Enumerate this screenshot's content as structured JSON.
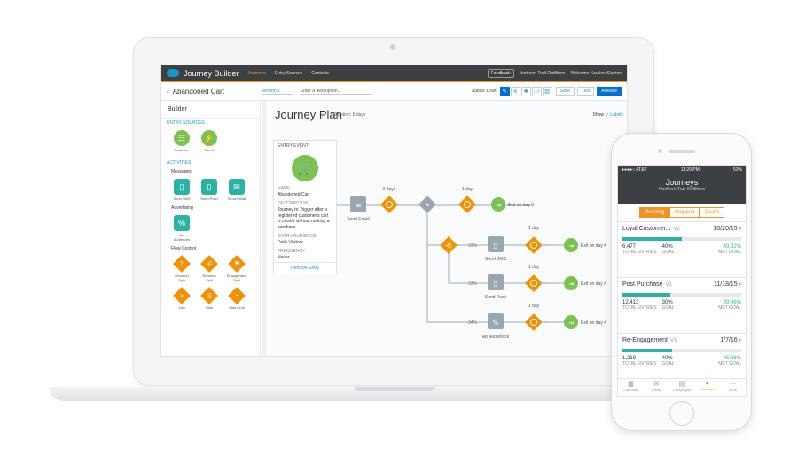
{
  "app": {
    "title": "Journey Builder",
    "nav": [
      "Journeys",
      "Entry Sources",
      "Contacts"
    ],
    "feedback": "Feedback",
    "org": "Northern Trail Outfitters",
    "welcome": "Welcome  Karalee Slayton"
  },
  "subbar": {
    "back": "‹",
    "journey_name": "Abandoned Cart",
    "version": "Version 1",
    "description_placeholder": "Enter a description...",
    "status": "Status: Draft",
    "save": "Save",
    "test": "Test",
    "activate": "Activate"
  },
  "builder": {
    "title": "Builder",
    "entry_sources": "ENTRY SOURCES",
    "entry_tiles": [
      "Audience",
      "Event"
    ],
    "activities": "ACTIVITIES",
    "messages": "Messages",
    "message_tiles": [
      "Send SMS",
      "Send Push",
      "Send Email"
    ],
    "advertising": "Advertising",
    "ad_tiles": [
      "Ad Audiences"
    ],
    "flow_control": "Flow Control",
    "flow_tiles_1": [
      "Decision Split",
      "Random Split",
      "Engagement Split"
    ],
    "flow_tiles_2": [
      "Join",
      "Wait",
      "Wait Limit"
    ]
  },
  "canvas": {
    "title": "Journey Plan",
    "duration": "Duration: 5 days",
    "show": "Show",
    "labels": "✓ Labels",
    "entry": {
      "label": "ENTRY EVENT",
      "name_key": "NAME",
      "name_val": "Abandoned Cart",
      "desc_key": "DESCRIPTION",
      "desc_val": "Journey to Trigger after a registered customer's cart is closed without making a purchase",
      "aud_key": "ENTRY AUDIENCE",
      "aud_val": "Daily Visitors",
      "freq_key": "FREQUENCY",
      "freq_val": "Never",
      "remove": "Remove Entry"
    },
    "nodes": {
      "send_email": "Send Email",
      "d1": "2 days",
      "d2": "1 day",
      "exit1": "Exit on day 3",
      "send_sms": "Send SMS",
      "send_push": "Send Push",
      "ad_aud": "Ad Audiences",
      "d3": "1 day",
      "d4": "1 day",
      "d5": "1 day",
      "exit2": "Exit on day 4",
      "exit3": "Exit on day 4",
      "exit4": "Exit on day 4",
      "p1": "33%",
      "p2": "33%",
      "p3": "34%"
    }
  },
  "phone": {
    "carrier": "●●●●○ AT&T",
    "time": "11:20 PM",
    "battery": "53%",
    "title": "Journeys",
    "subtitle": "Northern Trail Outfitters",
    "tabs": [
      "Running",
      "Stopped",
      "Drafts"
    ],
    "cards": [
      {
        "name": "Loyal Customer...",
        "ver": "V2",
        "date": "10/20/15",
        "fill": 0.5,
        "entries": "6,477",
        "goal": "40%",
        "met": "49.92%",
        "l1": "TOTAL ENTRIES",
        "l2": "GOAL",
        "l3": "MET GOAL"
      },
      {
        "name": "Post Purchase",
        "ver": "V1",
        "date": "11/18/15",
        "fill": 0.4,
        "entries": "12,413",
        "goal": "30%",
        "met": "39.46%",
        "l1": "TOTAL ENTRIES",
        "l2": "GOAL",
        "l3": "MET GOAL"
      },
      {
        "name": "Re-Engagement",
        "ver": "V1",
        "date": "1/7/16",
        "fill": 0.42,
        "entries": "1,219",
        "goal": "40%",
        "met": "45.86%",
        "l1": "TOTAL ENTRIES",
        "l2": "GOAL",
        "l3": "MET GOAL"
      }
    ],
    "tabbar": [
      "Calendar",
      "Email",
      "Campaigns",
      "Journeys",
      "More"
    ]
  },
  "colors": {
    "accent": "#f29222",
    "teal": "#2ab3a5",
    "green": "#7cc24f",
    "brand": "#0070d2"
  }
}
